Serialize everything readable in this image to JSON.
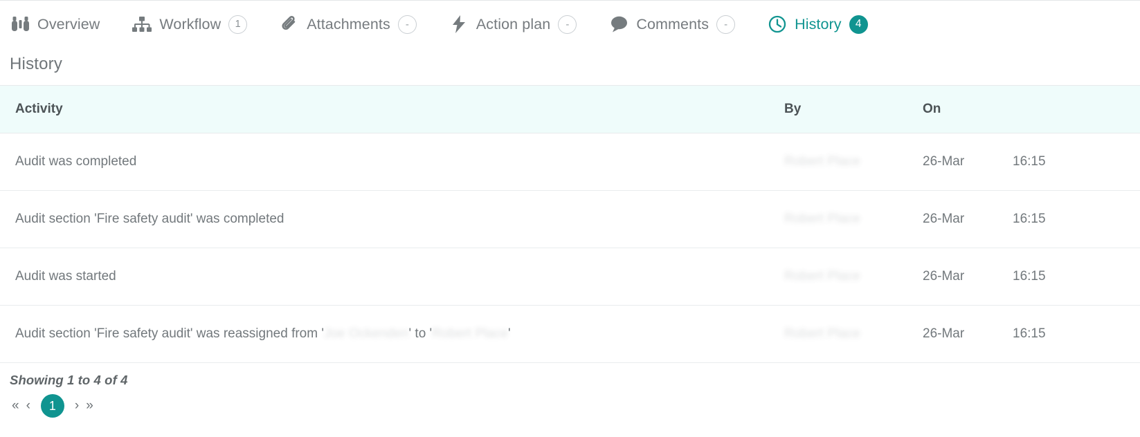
{
  "accent_color": "#109490",
  "header_row_bg": "#effcfb",
  "tabs": [
    {
      "label": "Overview",
      "icon": "binoculars-icon",
      "badge": null,
      "active": false
    },
    {
      "label": "Workflow",
      "icon": "sitemap-icon",
      "badge": "1",
      "active": false
    },
    {
      "label": "Attachments",
      "icon": "paperclip-icon",
      "badge": "-",
      "active": false
    },
    {
      "label": "Action plan",
      "icon": "lightning-icon",
      "badge": "-",
      "active": false
    },
    {
      "label": "Comments",
      "icon": "comment-icon",
      "badge": "-",
      "active": false
    },
    {
      "label": "History",
      "icon": "clock-icon",
      "badge": "4",
      "active": true
    }
  ],
  "section": {
    "title": "History"
  },
  "table": {
    "columns": [
      "Activity",
      "By",
      "On",
      ""
    ],
    "rows": [
      {
        "activity_prefix": "Audit was completed",
        "activity_redacted_1": "",
        "activity_mid": "",
        "activity_redacted_2": "",
        "activity_suffix": "",
        "by": "Robert Place",
        "on": "26-Mar",
        "at": "16:15"
      },
      {
        "activity_prefix": "Audit section 'Fire safety audit' was completed",
        "activity_redacted_1": "",
        "activity_mid": "",
        "activity_redacted_2": "",
        "activity_suffix": "",
        "by": "Robert Place",
        "on": "26-Mar",
        "at": "16:15"
      },
      {
        "activity_prefix": "Audit was started",
        "activity_redacted_1": "",
        "activity_mid": "",
        "activity_redacted_2": "",
        "activity_suffix": "",
        "by": "Robert Place",
        "on": "26-Mar",
        "at": "16:15"
      },
      {
        "activity_prefix": "Audit section 'Fire safety audit' was reassigned from '",
        "activity_redacted_1": "Joe Ockenden",
        "activity_mid": "' to '",
        "activity_redacted_2": "Robert Place",
        "activity_suffix": "'",
        "by": "Robert Place",
        "on": "26-Mar",
        "at": "16:15"
      }
    ]
  },
  "footer": {
    "showing": "Showing 1 to 4 of 4",
    "pager": {
      "first": "«",
      "prev": "‹",
      "current": "1",
      "next": "›",
      "last": "»"
    }
  }
}
